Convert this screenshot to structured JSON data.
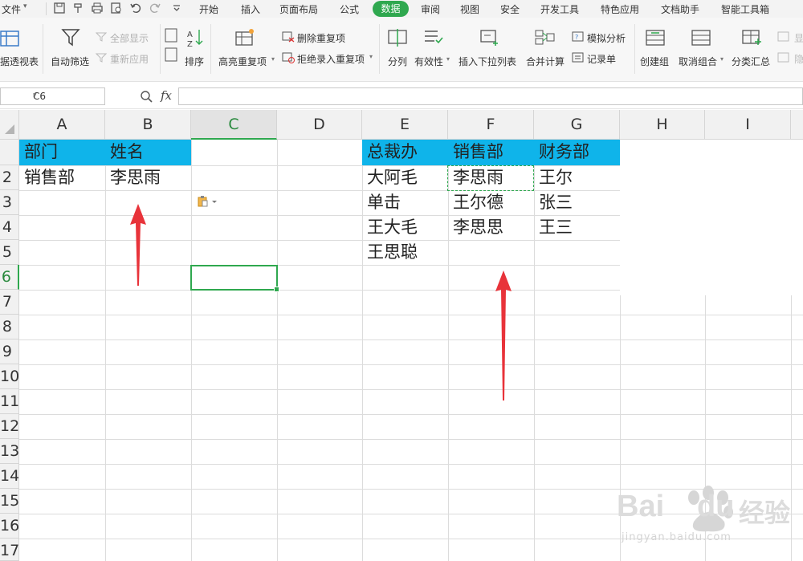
{
  "menu": {
    "file": "文件",
    "tabs": [
      "开始",
      "插入",
      "页面布局",
      "公式",
      "数据",
      "审阅",
      "视图",
      "安全",
      "开发工具",
      "特色应用",
      "文档助手",
      "智能工具箱"
    ],
    "active_tab": "数据",
    "active_color": "#2fa84f"
  },
  "ribbon": {
    "pivot_table": "据透视表",
    "auto_filter": "自动筛选",
    "show_all": "全部显示",
    "reapply": "重新应用",
    "sort": "排序",
    "highlight_dup": "高亮重复项",
    "remove_dup": "删除重复项",
    "reject_dup": "拒绝录入重复项",
    "split_col": "分列",
    "validity": "有效性",
    "insert_dropdown": "插入下拉列表",
    "consolidate": "合并计算",
    "what_if": "模拟分析",
    "record_form": "记录单",
    "create_group": "创建组",
    "ungroup": "取消组合",
    "subtotal": "分类汇总"
  },
  "formula_bar": {
    "name_box": "C6",
    "fx": "fx",
    "content": ""
  },
  "sheet": {
    "columns": [
      "A",
      "B",
      "C",
      "D",
      "E",
      "F",
      "G",
      "H",
      "I"
    ],
    "selected_column": "C",
    "rows": [
      "2",
      "3",
      "4",
      "5",
      "6",
      "7",
      "8",
      "9",
      "10",
      "11",
      "12",
      "13",
      "14",
      "15",
      "16",
      "17"
    ],
    "selected_row": "6",
    "header_fill": "#0fb4ea",
    "table1": {
      "headers": [
        "部门",
        "姓名"
      ],
      "row1": [
        "销售部",
        "李思雨"
      ]
    },
    "table2": {
      "headers": [
        "总裁办",
        "销售部",
        "财务部"
      ],
      "col_e": [
        "大阿毛",
        "单击",
        "王大毛",
        "王思聪"
      ],
      "col_f": [
        "李思雨",
        "王尔德",
        "李思思"
      ],
      "col_g": [
        "王尔",
        "张三",
        "王三"
      ]
    }
  },
  "watermark": {
    "brand": "Bai",
    "brand2": "du",
    "cn": "经验",
    "url": "jingyan.baidu.com"
  }
}
